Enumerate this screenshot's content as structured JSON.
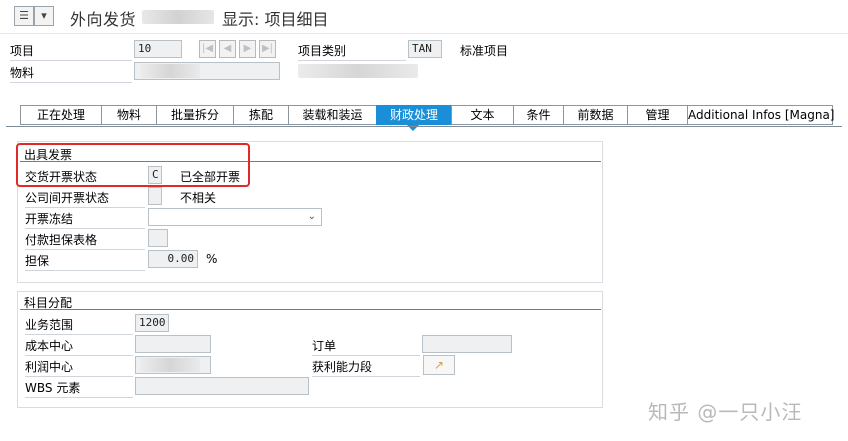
{
  "title": {
    "prefix": "外向发货",
    "suffix": "显示: 项目细目"
  },
  "header": {
    "item_label": "项目",
    "item_value": "10",
    "material_label": "物料",
    "item_category_label": "项目类别",
    "item_category_value": "TAN",
    "item_category_desc": "标准项目"
  },
  "tabs": [
    {
      "label": "正在处理"
    },
    {
      "label": "物料"
    },
    {
      "label": "批量拆分"
    },
    {
      "label": "拣配"
    },
    {
      "label": "装载和装运"
    },
    {
      "label": "财政处理"
    },
    {
      "label": "文本"
    },
    {
      "label": "条件"
    },
    {
      "label": "前数据"
    },
    {
      "label": "管理"
    },
    {
      "label": "Additional Infos [Magna]"
    }
  ],
  "active_tab": "财政处理",
  "billing": {
    "group_title": "出具发票",
    "delivery_billing_status_label": "交货开票状态",
    "delivery_billing_status_value": "C",
    "delivery_billing_status_desc": "已全部开票",
    "intercompany_billing_status_label": "公司间开票状态",
    "intercompany_billing_status_desc": "不相关",
    "billing_block_label": "开票冻结",
    "payment_guarantee_label": "付款担保表格",
    "guarantee_label": "担保",
    "guarantee_value": "0.00",
    "guarantee_unit": "%"
  },
  "account_assignment": {
    "group_title": "科目分配",
    "business_area_label": "业务范围",
    "business_area_value": "1200",
    "cost_center_label": "成本中心",
    "order_label": "订单",
    "profit_center_label": "利润中心",
    "profitability_segment_label": "获利能力段",
    "wbs_label": "WBS 元素"
  },
  "watermark": "知乎 @一只小汪",
  "colors": {
    "active_tab": "#1a8fd8",
    "group_rule": "#3a8fbd",
    "highlight": "#e02a2a"
  }
}
